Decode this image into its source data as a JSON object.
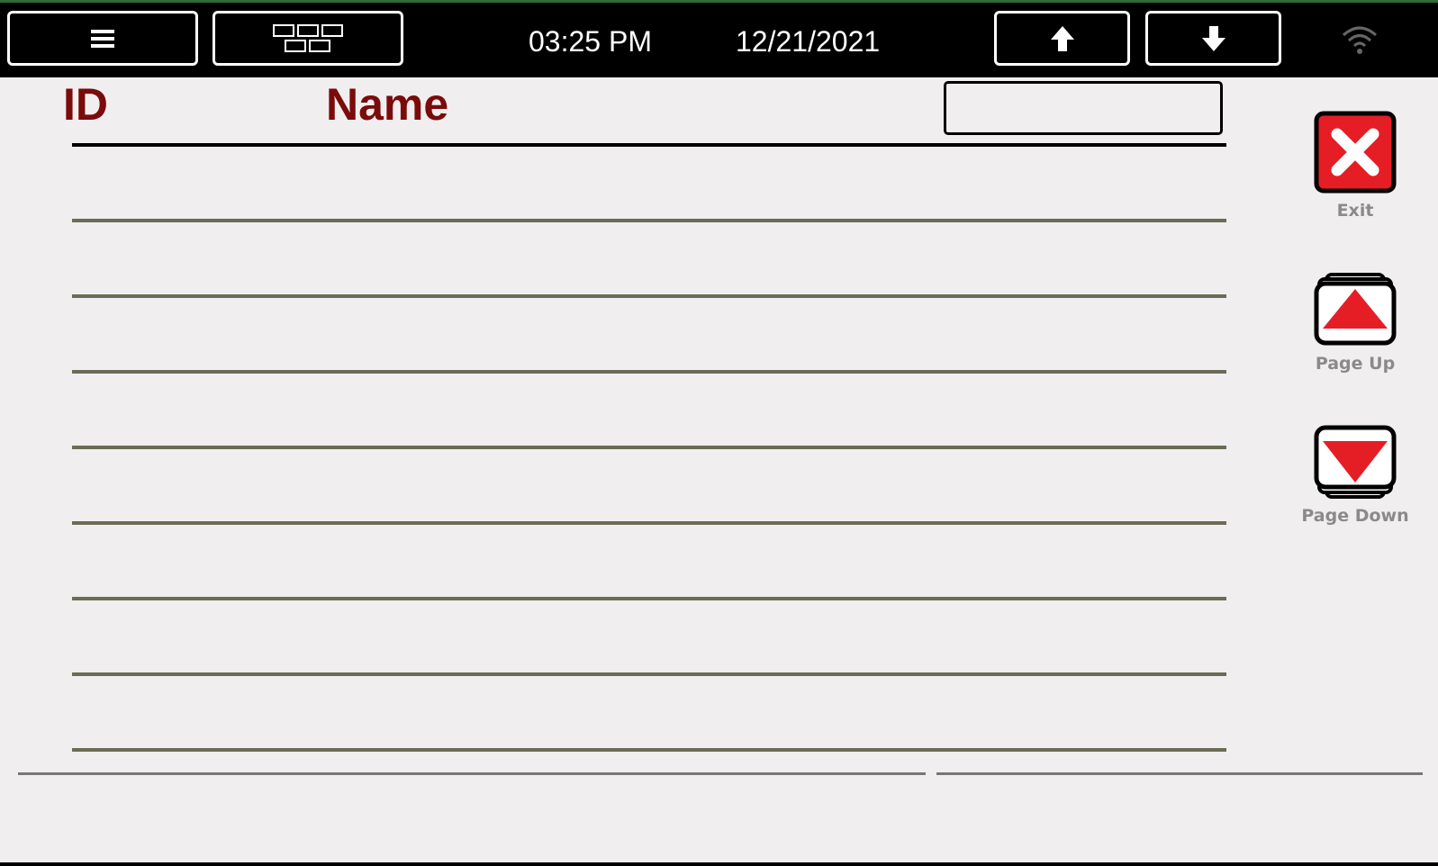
{
  "topbar": {
    "time": "03:25 PM",
    "date": "12/21/2021",
    "menu_icon": "hamburger-icon",
    "layout_icon": "grid-layout-icon",
    "up_icon": "arrow-up-icon",
    "down_icon": "arrow-down-icon",
    "wifi_icon": "wifi-icon"
  },
  "table": {
    "col_id": "ID",
    "col_name": "Name",
    "search_value": "",
    "rows": [
      {},
      {},
      {},
      {},
      {},
      {},
      {},
      {}
    ]
  },
  "sidebar": {
    "exit_label": "Exit",
    "page_up_label": "Page Up",
    "page_down_label": "Page Down"
  },
  "colors": {
    "header_text": "#7b0b0b",
    "accent_red": "#e51e26",
    "row_rule": "#6b6c54"
  }
}
